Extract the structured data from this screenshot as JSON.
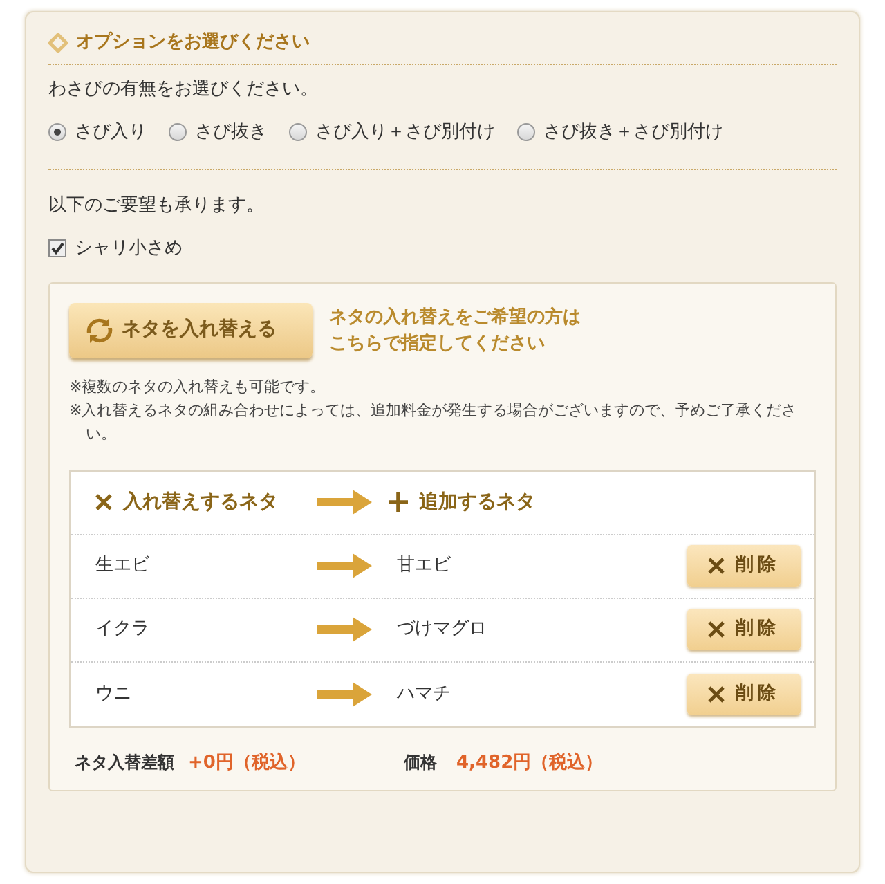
{
  "section": {
    "title": "オプションをお選びください"
  },
  "wasabi": {
    "prompt": "わさびの有無をお選びください。",
    "options": [
      {
        "label": "さび入り",
        "selected": true
      },
      {
        "label": "さび抜き",
        "selected": false
      },
      {
        "label": "さび入り＋さび別付け",
        "selected": false
      },
      {
        "label": "さび抜き＋さび別付け",
        "selected": false
      }
    ]
  },
  "requests": {
    "prompt": "以下のご要望も承ります。",
    "options": [
      {
        "label": "シャリ小さめ",
        "checked": true
      }
    ]
  },
  "swap": {
    "button": "ネタを入れ替える",
    "hint": [
      "ネタの入れ替えをご希望の方は",
      "こちらで指定してください"
    ],
    "notes": [
      "※複数のネタの入れ替えも可能です。",
      "※入れ替えるネタの組み合わせによっては、追加料金が発生する場合がございますので、予めご了承ください。"
    ],
    "table": {
      "from_header": "入れ替えするネタ",
      "to_header": "追加するネタ",
      "rows": [
        {
          "from": "生エビ",
          "to": "甘エビ",
          "action": "削除"
        },
        {
          "from": "イクラ",
          "to": "づけマグロ",
          "action": "削除"
        },
        {
          "from": "ウニ",
          "to": "ハマチ",
          "action": "削除"
        }
      ]
    },
    "summary": {
      "diff_label": "ネタ入替差額",
      "diff_value": "+0円（税込）",
      "price_label": "価格",
      "price_value": "4,482円（税込）"
    }
  }
}
